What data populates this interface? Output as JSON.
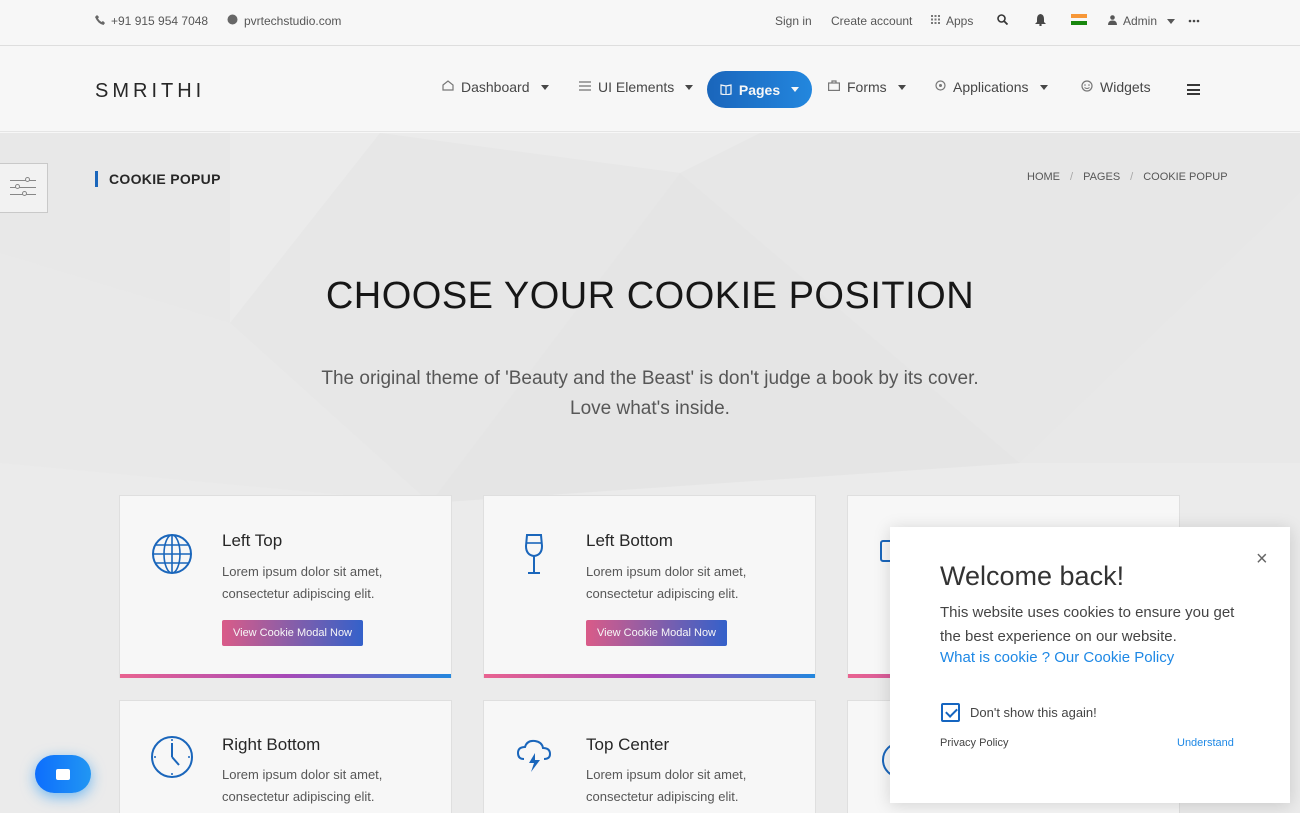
{
  "topbar": {
    "phone": "+91 915 954 7048",
    "website": "pvrtechstudio.com",
    "sign_in": "Sign in",
    "create_account": "Create account",
    "apps": "Apps",
    "admin": "Admin"
  },
  "nav": {
    "logo": "SMRITHI",
    "dashboard": "Dashboard",
    "ui_elements": "UI Elements",
    "pages": "Pages",
    "forms": "Forms",
    "applications": "Applications",
    "widgets": "Widgets"
  },
  "page": {
    "title": "COOKIE POPUP",
    "breadcrumb": [
      "HOME",
      "PAGES",
      "COOKIE POPUP"
    ],
    "headline": "CHOOSE YOUR COOKIE POSITION",
    "subline_1": "The original theme of 'Beauty and the Beast' is don't judge a book by its cover.",
    "subline_2": "Love what's inside."
  },
  "cards": [
    {
      "title": "Left Top",
      "text_1": "Lorem ipsum dolor sit amet,",
      "text_2": "consectetur adipiscing elit.",
      "button": "View Cookie Modal Now",
      "icon": "globe-icon"
    },
    {
      "title": "Left Bottom",
      "text_1": "Lorem ipsum dolor sit amet,",
      "text_2": "consectetur adipiscing elit.",
      "button": "View Cookie Modal Now",
      "icon": "wine-glass-icon"
    },
    {
      "title": "Right Bottom",
      "text_1": "Lorem ipsum dolor sit amet,",
      "text_2": "consectetur adipiscing elit.",
      "icon": "clock-icon"
    },
    {
      "title": "Top Center",
      "text_1": "Lorem ipsum dolor sit amet,",
      "text_2": "consectetur adipiscing elit.",
      "icon": "cloud-lightning-icon"
    }
  ],
  "cookie": {
    "title": "Welcome back!",
    "body": "This website uses cookies to ensure you get the best experience on our website.",
    "link": "What is cookie ? Our Cookie Policy",
    "checkbox_label": "Don't show this again!",
    "privacy": "Privacy Policy",
    "understand": "Understand",
    "close": "×"
  },
  "colors": {
    "accent": "#1565c0",
    "link": "#1e88e5",
    "button_gradient_start": "#e05a8a",
    "button_gradient_end": "#3060d0"
  }
}
